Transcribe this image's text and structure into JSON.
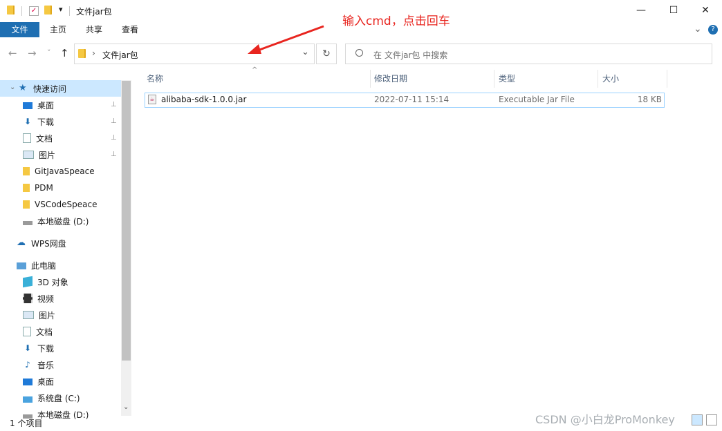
{
  "window": {
    "title": "文件jar包",
    "minimize_glyph": "—",
    "maximize_glyph": "☐",
    "close_glyph": "✕"
  },
  "ribbon": {
    "tabs": [
      "文件",
      "主页",
      "共享",
      "查看"
    ],
    "expand_glyph": "⌄",
    "help_glyph": "?"
  },
  "nav": {
    "back_glyph": "←",
    "forward_glyph": "→",
    "recent_glyph": "˅",
    "up_glyph": "↑",
    "breadcrumb_sep": "›",
    "path": "文件jar包",
    "dropdown_glyph": "⌄",
    "refresh_glyph": "↻",
    "search_placeholder": "在 文件jar包 中搜索"
  },
  "sidebar": {
    "quick_access": "快速访问",
    "items": [
      {
        "label": "桌面",
        "icon": "desktop-icon",
        "pinned": true
      },
      {
        "label": "下载",
        "icon": "download-icon",
        "pinned": true
      },
      {
        "label": "文档",
        "icon": "document-icon",
        "pinned": true
      },
      {
        "label": "图片",
        "icon": "picture-icon",
        "pinned": true
      },
      {
        "label": "GitJavaSpeace",
        "icon": "folder-icon",
        "pinned": false
      },
      {
        "label": "PDM",
        "icon": "folder-icon",
        "pinned": false
      },
      {
        "label": "VSCodeSpeace",
        "icon": "folder-icon",
        "pinned": false
      },
      {
        "label": "本地磁盘 (D:)",
        "icon": "drive-icon",
        "pinned": false
      }
    ],
    "wps": "WPS网盘",
    "this_pc": "此电脑",
    "pc_items": [
      {
        "label": "3D 对象",
        "icon": "3d-objects-icon"
      },
      {
        "label": "视频",
        "icon": "video-icon"
      },
      {
        "label": "图片",
        "icon": "picture-icon"
      },
      {
        "label": "文档",
        "icon": "document-icon"
      },
      {
        "label": "下载",
        "icon": "download-icon"
      },
      {
        "label": "音乐",
        "icon": "music-icon"
      },
      {
        "label": "桌面",
        "icon": "desktop-icon"
      },
      {
        "label": "系统盘 (C:)",
        "icon": "system-drive-icon"
      },
      {
        "label": "本地磁盘 (D:)",
        "icon": "drive-icon"
      }
    ]
  },
  "list": {
    "columns": [
      "名称",
      "修改日期",
      "类型",
      "大小"
    ],
    "rows": [
      {
        "name": "alibaba-sdk-1.0.0.jar",
        "date": "2022-07-11 15:14",
        "type": "Executable Jar File",
        "size": "18 KB"
      }
    ]
  },
  "status": {
    "count": "1 个项目"
  },
  "annotation": {
    "text": "输入cmd，点击回车",
    "color": "#e8251f"
  },
  "watermark": "CSDN @小白龙ProMonkey",
  "colors": {
    "accent": "#1f6fb2",
    "selection_border": "#99d1ff",
    "folder": "#f5c842"
  }
}
